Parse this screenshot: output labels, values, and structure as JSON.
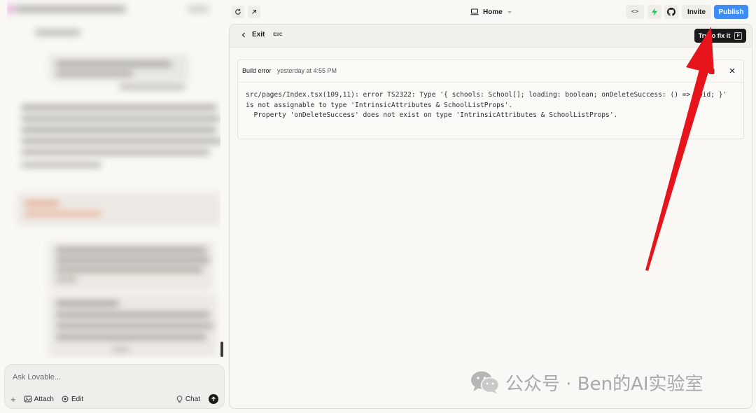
{
  "sidebar": {
    "chat_placeholder": "Ask Lovable...",
    "attach_label": "Attach",
    "edit_label": "Edit",
    "chat_label": "Chat"
  },
  "topbar": {
    "page_selector": "Home",
    "invite_label": "Invite",
    "publish_label": "Publish"
  },
  "preview": {
    "exit_label": "Exit",
    "esc_hint": "ESC",
    "fix_label": "Try to fix it",
    "fix_shortcut": "F",
    "error": {
      "title": "Build error",
      "timestamp": "yesterday at 4:55 PM",
      "message": "src/pages/Index.tsx(109,11): error TS2322: Type '{ schools: School[]; loading: boolean; onDeleteSuccess: () => void; }'\nis not assignable to type 'IntrinsicAttributes & SchoolListProps'.\n  Property 'onDeleteSuccess' does not exist on type 'IntrinsicAttributes & SchoolListProps'."
    }
  },
  "watermark": {
    "text": "公众号 · Ben的AI实验室"
  },
  "colors": {
    "publish_blue": "#3d8cf7",
    "lightning_green": "#22c55e",
    "annotation_red": "#e8141c"
  }
}
